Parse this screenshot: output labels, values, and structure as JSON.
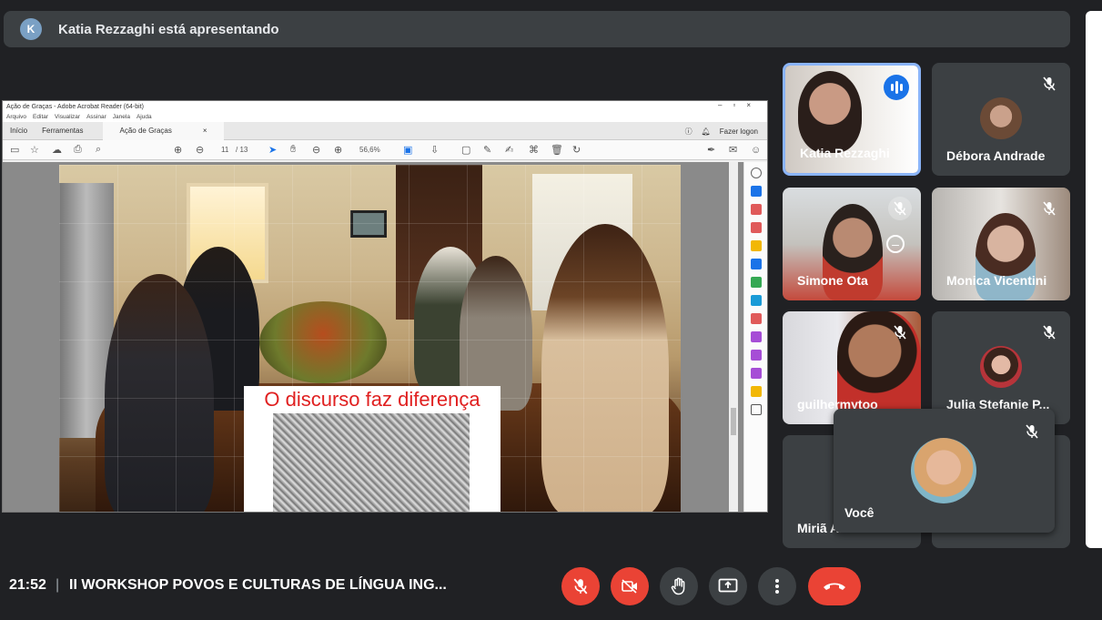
{
  "banner": {
    "avatar_letter": "K",
    "text": "Katia Rezzaghi está apresentando"
  },
  "shared_screen": {
    "window_title": "Ação de Graças - Adobe Acrobat Reader (64-bit)",
    "menu": [
      "Arquivo",
      "Editar",
      "Visualizar",
      "Assinar",
      "Janela",
      "Ajuda"
    ],
    "tabs": {
      "home": "Início",
      "tools": "Ferramentas",
      "document": "Ação de Graças",
      "close": "×"
    },
    "sign_in": "Fazer logon",
    "page_current": "11",
    "page_total": "/ 13",
    "zoom": "56,6%",
    "slide_title": "O discurso faz diferença"
  },
  "participants": [
    {
      "name": "Katia Rezzaghi",
      "speaking": true
    },
    {
      "name": "Débora Andrade",
      "muted": true
    },
    {
      "name": "Simone Ota",
      "muted": true
    },
    {
      "name": "Monica Vicentini",
      "muted": true
    },
    {
      "name": "guilhermytoo",
      "muted": true
    },
    {
      "name": "Julia Stefanie P...",
      "muted": true
    },
    {
      "name": "Miriã A..."
    }
  ],
  "self": {
    "name": "Você",
    "muted": true
  },
  "bottom_bar": {
    "time": "21:52",
    "separator": "|",
    "meeting_title": "II WORKSHOP POVOS E CULTURAS DE LÍNGUA ING..."
  },
  "colors": {
    "background": "#202124",
    "tile": "#3c4043",
    "danger": "#ea4335",
    "active_border": "#8ab4f8",
    "speaking": "#1a73e8"
  }
}
